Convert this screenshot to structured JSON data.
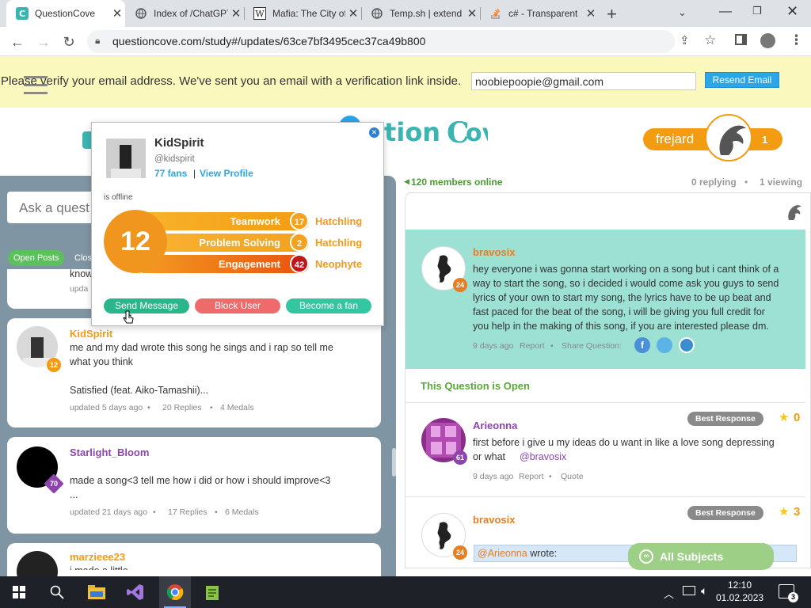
{
  "browser": {
    "tabs": [
      {
        "title": "QuestionCove",
        "icon": "questioncove-icon",
        "active": true
      },
      {
        "title": "Index of /ChatGPT",
        "icon": "globe-icon",
        "active": false
      },
      {
        "title": "Mafia: The City of Lost Heaven",
        "icon": "wikipedia-icon",
        "active": false
      },
      {
        "title": "Temp.sh | extend",
        "icon": "globe-icon",
        "active": false
      },
      {
        "title": "c# - Transparent",
        "icon": "stackoverflow-icon",
        "active": false
      }
    ],
    "new_tab": "+",
    "url": "questioncove.com/study#/updates/63ce7bf3495cec37ca49b800"
  },
  "verify_banner": {
    "text": "Please verify your email address. We've sent you an email with a verification link inside.",
    "email": "noobiepoopie@gmail.com",
    "button": "Resend Email"
  },
  "header": {
    "user": "frejard",
    "notifications": "1"
  },
  "left": {
    "ask_placeholder": "Ask a quest",
    "tab_open": "Open Posts",
    "tab_closed": "Clos",
    "partial_top": {
      "text": "know",
      "meta": "upda"
    },
    "posts": [
      {
        "user": "KidSpirit",
        "level": "12",
        "text_lines": [
          "me and my dad wrote this song he sings and i rap so tell me",
          "what you think"
        ],
        "extra": "Satisfied (feat. Aiko-Tamashii)...",
        "updated": "updated 5 days ago",
        "replies": "20 Replies",
        "medals": "4 Medals"
      },
      {
        "user": "Starlight_Bloom",
        "level": "70",
        "text_lines": [
          "made a song<3 tell me how i did or how i should improve<3",
          "..."
        ],
        "updated": "updated 21 days ago",
        "replies": "17 Replies",
        "medals": "6 Medals"
      },
      {
        "user": "marzieee23",
        "text_lines": [
          "i made a little..."
        ]
      }
    ]
  },
  "right": {
    "online": "120 members online",
    "replying": "0 replying",
    "viewing": "1 viewing",
    "question": {
      "user": "bravosix",
      "level": "24",
      "text_lines": [
        "hey everyone i was gonna start working on a song but i cant think of a",
        "way to start the song, so i decided i would come ask you guys to send",
        "lyrics of your own to start my song, the lyrics have to be up beat and",
        "fast paced for the beat of the song, i will be giving you full credit for",
        "you help in the making of this song, if you are interested please dm."
      ],
      "time": "9 days ago",
      "report": "Report",
      "share": "Share Question:"
    },
    "open_label": "This Question is Open",
    "replies": [
      {
        "user": "Arieonna",
        "level": "61",
        "text_lines": [
          "first before i give u my ideas do u want in like a love song depressing",
          "or what"
        ],
        "mention": "@bravosix",
        "time": "9 days ago",
        "report": "Report",
        "quote": "Quote",
        "best": "Best Response",
        "medals": "0"
      },
      {
        "user": "bravosix",
        "level": "24",
        "best": "Best Response",
        "medals": "3",
        "quote_mention": "@Arieonna",
        "quote_wrote": "wrote:"
      }
    ],
    "all_subjects": "All Subjects"
  },
  "popup": {
    "name": "KidSpirit",
    "handle": "@kidspirit",
    "fans": "77 fans",
    "sep": "|",
    "view_profile": "View Profile",
    "status": "is offline",
    "level": "12",
    "stats": [
      {
        "label": "Teamwork",
        "value": "17",
        "rank": "Hatchling"
      },
      {
        "label": "Problem Solving",
        "value": "2",
        "rank": "Hatchling"
      },
      {
        "label": "Engagement",
        "value": "42",
        "rank": "Neophyte"
      }
    ],
    "buttons": {
      "send": "Send Message",
      "block": "Block User",
      "fan": "Become a fan"
    }
  },
  "taskbar": {
    "time": "12:10",
    "date": "01.02.2023"
  }
}
